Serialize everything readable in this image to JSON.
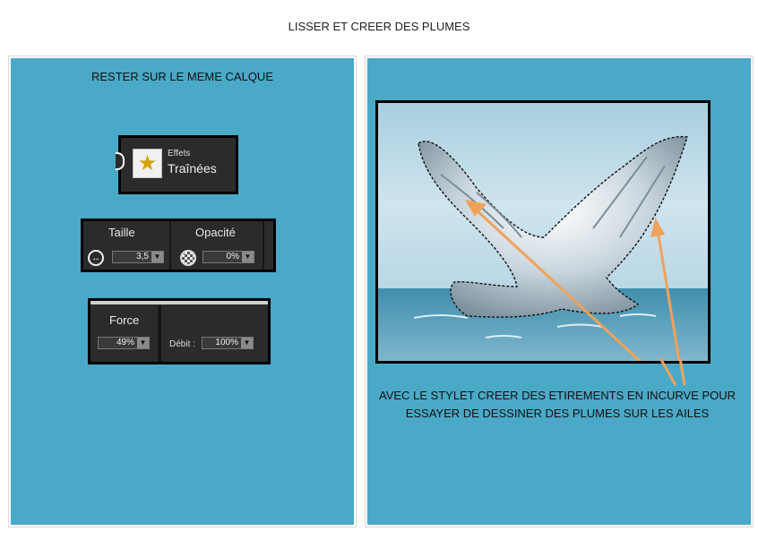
{
  "title": "LISSER ET CREER DES PLUMES",
  "left_panel": {
    "caption": "RESTER SUR LE MEME CALQUE",
    "effets_widget": {
      "small_label": "Effets",
      "big_label": "Traînées",
      "icon": "star-icon"
    },
    "taille_widget": {
      "taille_label": "Taille",
      "taille_value": "3,5",
      "opacite_label": "Opacité",
      "opacite_value": "0%",
      "icons": [
        "resize-arrows-icon",
        "checkerboard-icon"
      ]
    },
    "force_widget": {
      "force_label": "Force",
      "force_value": "49%",
      "debit_label": "Débit :",
      "debit_value": "100%"
    }
  },
  "right_panel": {
    "caption_line1": "AVEC LE STYLET CREER DES ETIREMENTS  EN INCURVE POUR",
    "caption_line2": "ESSAYER DE DESSINER DES PLUMES SUR LES AILES"
  },
  "colors": {
    "panel": "#4aa9c7",
    "widget_bg": "#2b2b2b",
    "arrow": "#f0a25a",
    "sea": "#3f8fae"
  }
}
